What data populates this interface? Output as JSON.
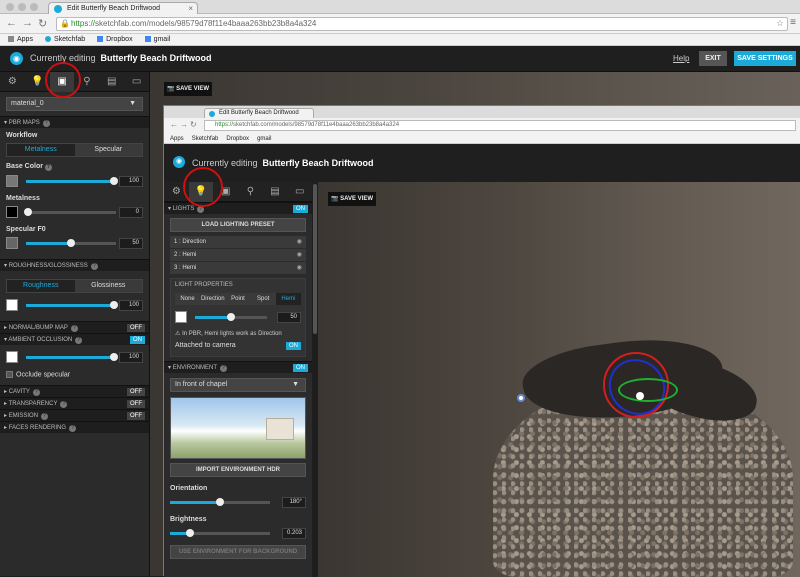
{
  "browser": {
    "tab_title": "Edit Butterfly Beach Driftwood",
    "url_scheme": "https://",
    "url_rest": "sketchfab.com/models/98579d78f11e4baaa263bb23b8a4a324",
    "bookmarks": [
      "Apps",
      "Sketchfab",
      "Dropbox",
      "gmail"
    ]
  },
  "app": {
    "currently_editing": "Currently editing",
    "model_name": "Butterfly Beach Driftwood",
    "help": "Help",
    "exit": "EXIT",
    "save_settings": "SAVE SETTINGS",
    "save_view": "SAVE VIEW",
    "accent_color": "#1caad9"
  },
  "material_panel": {
    "material_select": "material_0",
    "pbr_maps": "PBR MAPS",
    "workflow_label": "Workflow",
    "workflow_options": [
      "Metalness",
      "Specular"
    ],
    "workflow_selected": "Metalness",
    "base_color": {
      "label": "Base Color",
      "value": "100",
      "level": 1.0
    },
    "metalness": {
      "label": "Metalness",
      "value": "0",
      "level": 0.0
    },
    "specular_f0": {
      "label": "Specular F0",
      "value": "50",
      "level": 0.5
    },
    "roughness_section": "ROUGHNESS/GLOSSINESS",
    "roughness_options": [
      "Roughness",
      "Glossiness"
    ],
    "roughness_selected": "Roughness",
    "roughness_value": {
      "value": "100",
      "level": 1.0
    },
    "normal_bump": {
      "label": "NORMAL/BUMP MAP",
      "state": "OFF"
    },
    "ambient_occlusion": {
      "label": "AMBIENT OCCLUSION",
      "state": "ON",
      "value": "100",
      "level": 1.0
    },
    "occlude_specular": "Occlude specular",
    "cavity": {
      "label": "CAVITY",
      "state": "OFF"
    },
    "transparency": {
      "label": "TRANSPARENCY",
      "state": "OFF"
    },
    "emission": {
      "label": "EMISSION",
      "state": "OFF"
    },
    "faces_rendering": "FACES RENDERING"
  },
  "nested": {
    "lights": {
      "label": "LIGHTS",
      "state": "ON"
    },
    "load_preset": "LOAD LIGHTING PRESET",
    "light_items": [
      "1 : Direction",
      "2 : Hemi",
      "3 : Hemi"
    ],
    "light_properties": "LIGHT PROPERTIES",
    "light_types": [
      "None",
      "Direction",
      "Point",
      "Spot",
      "Hemi"
    ],
    "light_type_selected": "Hemi",
    "light_value": {
      "value": "50",
      "level": 0.5
    },
    "pbr_note": "In PBR, Hemi lights work as Direction",
    "attached_camera": "Attached to camera",
    "attached_state": "ON",
    "environment": {
      "label": "ENVIRONMENT",
      "state": "ON"
    },
    "environment_select": "In front of chapel",
    "import_hdr": "IMPORT ENVIRONMENT HDR",
    "orientation": {
      "label": "Orientation",
      "value": "180°",
      "level": 0.5
    },
    "brightness": {
      "label": "Brightness",
      "value": "0.203",
      "level": 0.2
    },
    "use_env_bg": "USE ENVIRONMENT FOR BACKGROUND"
  }
}
